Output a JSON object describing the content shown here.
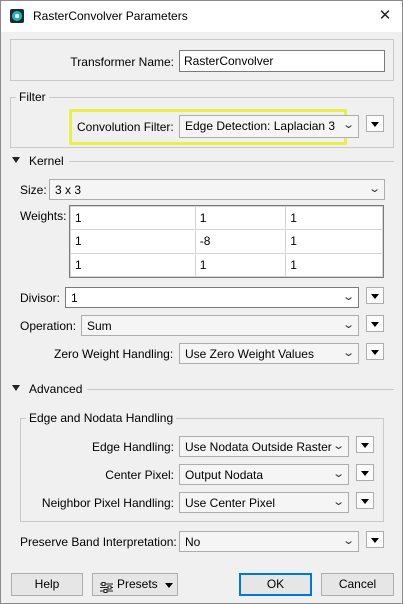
{
  "window": {
    "title": "RasterConvolver Parameters",
    "close_glyph": "✕",
    "icon": "fme-app-icon"
  },
  "transformer_name": {
    "label": "Transformer Name:",
    "value": "RasterConvolver"
  },
  "filter": {
    "group_title": "Filter",
    "convolution_filter_label": "Convolution Filter:",
    "convolution_filter_value": "Edge Detection: Laplacian 3",
    "highlight_color": "#e6f04a"
  },
  "kernel": {
    "section_title": "Kernel",
    "size_label": "Size:",
    "size_value": "3 x 3",
    "weights_label": "Weights:",
    "weights": [
      [
        "1",
        "1",
        "1"
      ],
      [
        "1",
        "-8",
        "1"
      ],
      [
        "1",
        "1",
        "1"
      ]
    ],
    "divisor_label": "Divisor:",
    "divisor_value": "1",
    "operation_label": "Operation:",
    "operation_value": "Sum",
    "zero_weight_label": "Zero Weight Handling:",
    "zero_weight_value": "Use Zero Weight Values"
  },
  "advanced": {
    "section_title": "Advanced",
    "group_title": "Edge and Nodata Handling",
    "edge_label": "Edge Handling:",
    "edge_value": "Use Nodata Outside Raster",
    "center_label": "Center Pixel:",
    "center_value": "Output Nodata",
    "neighbor_label": "Neighbor Pixel Handling:",
    "neighbor_value": "Use Center Pixel",
    "preserve_label": "Preserve Band Interpretation:",
    "preserve_value": "No"
  },
  "footer": {
    "help": "Help",
    "presets": "Presets",
    "ok": "OK",
    "cancel": "Cancel"
  },
  "colors": {
    "accent": "#0078d7",
    "highlight": "#e6f04a",
    "background": "#f0f0f0"
  }
}
